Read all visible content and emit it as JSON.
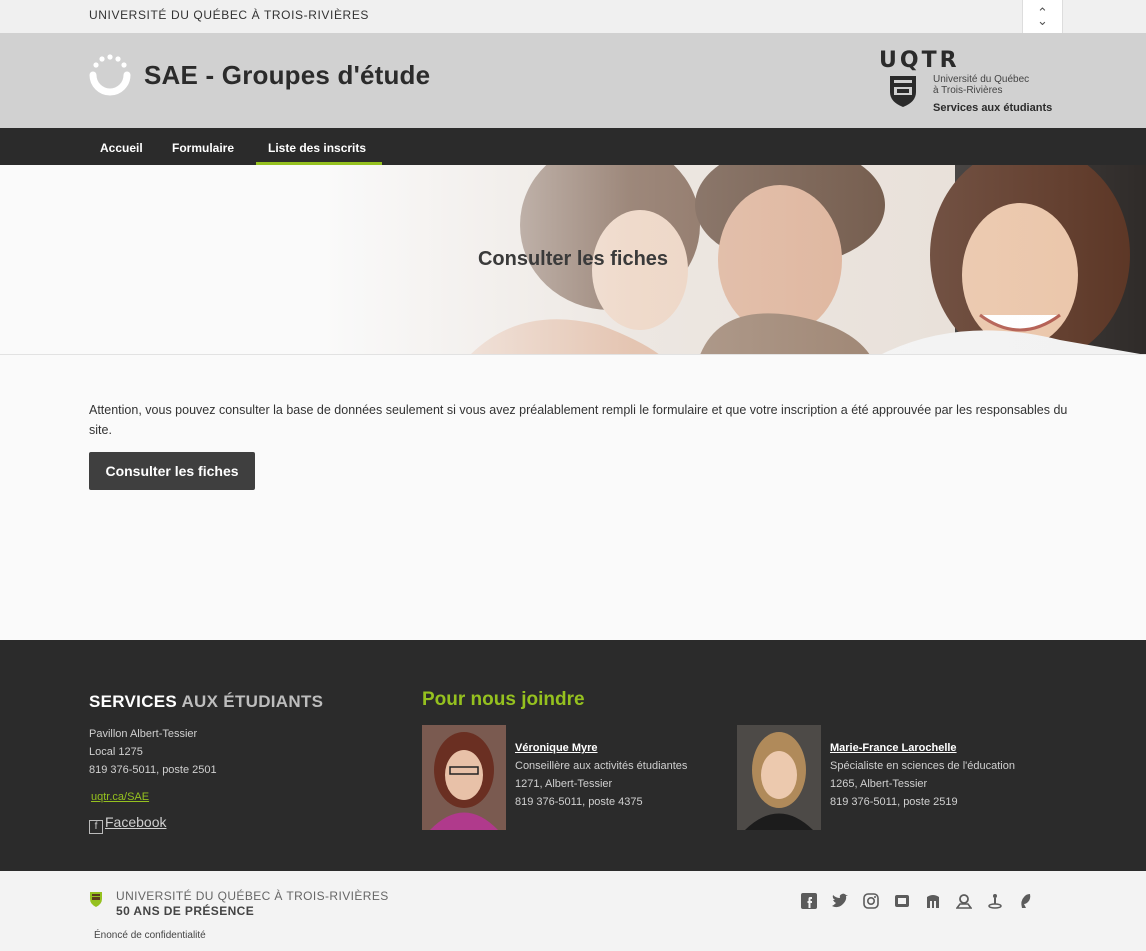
{
  "topbar": {
    "university": "UNIVERSITÉ DU QUÉBEC À TROIS-RIVIÈRES"
  },
  "header": {
    "title": "SAE - Groupes d'étude",
    "uqtr_mark": "UQTR",
    "uqtr_line1": "Université du Québec",
    "uqtr_line2": "à Trois-Rivières",
    "uqtr_line3": "Services aux étudiants"
  },
  "nav": {
    "items": [
      "Accueil",
      "Formulaire",
      "Liste des inscrits"
    ],
    "active": "Liste des inscrits"
  },
  "hero": {
    "title": "Consulter les fiches"
  },
  "main": {
    "notice": "Attention, vous pouvez consulter la base de données seulement si vous avez préalablement rempli le formulaire et que votre inscription a été approuvée par les responsables du site.",
    "button_label": "Consulter les fiches"
  },
  "footer": {
    "sae_bold": "SERVICES",
    "sae_light": "AUX ÉTUDIANTS",
    "address": [
      "Pavillon Albert-Tessier",
      "Local 1275",
      "819 376-5011, poste 2501"
    ],
    "link": "uqtr.ca/SAE",
    "facebook": "Facebook",
    "contact_title": "Pour nous joindre",
    "contacts": [
      {
        "name": "Véronique Myre",
        "role": "Conseillère aux activités étudiantes",
        "office": "1271, Albert-Tessier",
        "phone": "819 376-5011, poste 4375"
      },
      {
        "name": "Marie-France Larochelle",
        "role": "Spécialiste en sciences de l'éducation",
        "office": "1265, Albert-Tessier",
        "phone": "819 376-5011, poste 2519"
      }
    ]
  },
  "bottom": {
    "university": "UNIVERSITÉ DU QUÉBEC À TROIS-RIVIÈRES",
    "anniversary": "50 ANS DE PRÉSENCE",
    "privacy": "Énoncé de confidentialité",
    "social_icons": [
      "facebook-icon",
      "twitter-icon",
      "instagram-icon",
      "youtube-icon",
      "library-icon",
      "map-icon",
      "location-icon",
      "sustainability-icon"
    ]
  },
  "colors": {
    "accent_green": "#95c11f",
    "dark": "#2b2b2b",
    "header_gray": "#d1d1d1"
  }
}
